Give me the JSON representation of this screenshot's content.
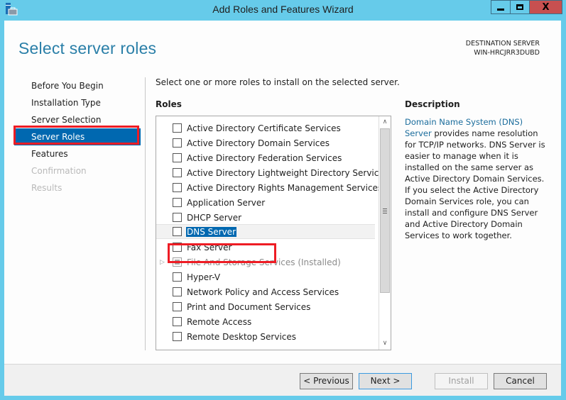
{
  "window": {
    "title": "Add Roles and Features Wizard",
    "app_icon": "server-manager-icon",
    "controls": {
      "minimize": "minimize-icon",
      "maximize": "maximize-icon",
      "close": "X"
    }
  },
  "header": {
    "page_title": "Select server roles",
    "destination_label": "DESTINATION SERVER",
    "destination_server": "WIN-HRCJRR3DUBD"
  },
  "nav": {
    "items": [
      {
        "label": "Before You Begin",
        "state": "normal"
      },
      {
        "label": "Installation Type",
        "state": "normal"
      },
      {
        "label": "Server Selection",
        "state": "normal"
      },
      {
        "label": "Server Roles",
        "state": "active"
      },
      {
        "label": "Features",
        "state": "normal"
      },
      {
        "label": "Confirmation",
        "state": "disabled"
      },
      {
        "label": "Results",
        "state": "disabled"
      }
    ]
  },
  "main": {
    "instruction": "Select one or more roles to install on the selected server.",
    "roles_label": "Roles",
    "roles": [
      {
        "label": "Active Directory Certificate Services",
        "checked": false
      },
      {
        "label": "Active Directory Domain Services",
        "checked": false
      },
      {
        "label": "Active Directory Federation Services",
        "checked": false
      },
      {
        "label": "Active Directory Lightweight Directory Services",
        "checked": false
      },
      {
        "label": "Active Directory Rights Management Services",
        "checked": false
      },
      {
        "label": "Application Server",
        "checked": false
      },
      {
        "label": "DHCP Server",
        "checked": false
      },
      {
        "label": "DNS Server",
        "checked": false,
        "selected": true
      },
      {
        "label": "Fax Server",
        "checked": false
      },
      {
        "label": "File And Storage Services (Installed)",
        "checked": "indeterminate",
        "disabled": true,
        "expandable": true
      },
      {
        "label": "Hyper-V",
        "checked": false
      },
      {
        "label": "Network Policy and Access Services",
        "checked": false
      },
      {
        "label": "Print and Document Services",
        "checked": false
      },
      {
        "label": "Remote Access",
        "checked": false
      },
      {
        "label": "Remote Desktop Services",
        "checked": false
      }
    ],
    "scrollbar": {
      "up": "^",
      "down": "v"
    }
  },
  "description": {
    "label": "Description",
    "link_text": "Domain Name System (DNS) Server",
    "body": "provides name resolution for TCP/IP networks. DNS Server is easier to manage when it is installed on the same server as Active Directory Domain Services. If you select the Active Directory Domain Services role, you can install and configure DNS Server and Active Directory Domain Services to work together."
  },
  "footer": {
    "previous": "< Previous",
    "next": "Next >",
    "install": "Install",
    "cancel": "Cancel"
  },
  "colors": {
    "accent": "#0068b0",
    "title_blue": "#2a7fa8",
    "frame": "#66cbea",
    "close": "#c75050",
    "annotation_red": "#ee1c24"
  }
}
